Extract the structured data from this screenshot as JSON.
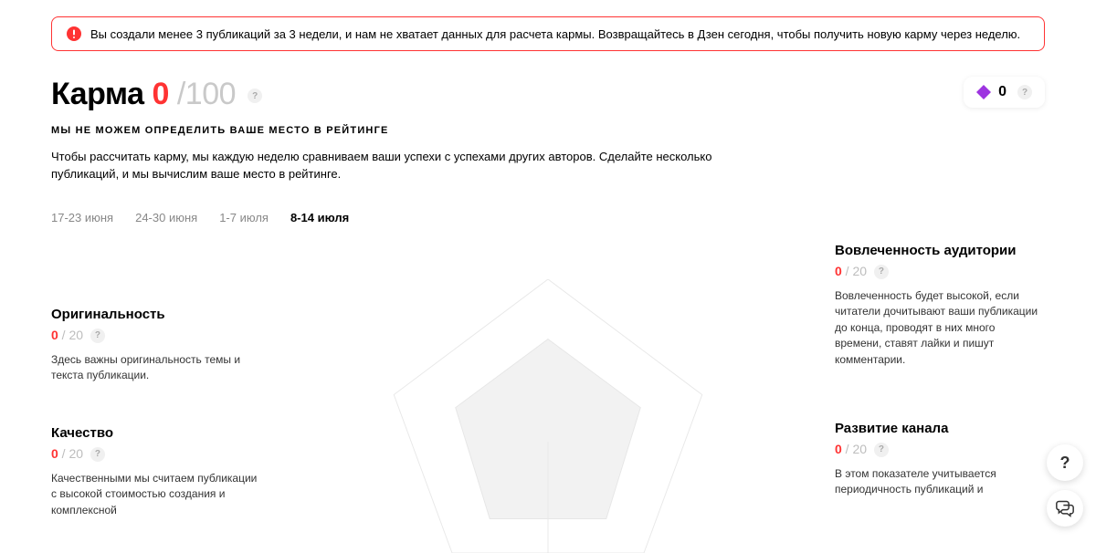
{
  "alert": {
    "text": "Вы создали менее 3 публикаций за 3 недели, и нам не хватает данных для расчета кармы. Возвращайтесь в Дзен сегодня, чтобы получить новую карму через неделю."
  },
  "header": {
    "title_word": "Карма",
    "score": "0",
    "score_sep": " /",
    "score_max": "100"
  },
  "bonus": {
    "value": "0"
  },
  "subtitle": "МЫ НЕ МОЖЕМ ОПРЕДЕЛИТЬ ВАШЕ МЕСТО В РЕЙТИНГЕ",
  "description": "Чтобы рассчитать карму, мы каждую неделю сравниваем ваши успехи с успехами других авторов. Сделайте несколько публикаций, и мы вычислим ваше место в рейтинге.",
  "tabs": [
    {
      "label": "17-23 июня",
      "active": false
    },
    {
      "label": "24-30 июня",
      "active": false
    },
    {
      "label": "1-7 июля",
      "active": false
    },
    {
      "label": "8-14 июля",
      "active": true
    }
  ],
  "metrics": {
    "originality": {
      "title": "Оригинальность",
      "score": "0",
      "sep": " / ",
      "max": "20",
      "desc": "Здесь важны оригинальность темы и текста публикации."
    },
    "quality": {
      "title": "Качество",
      "score": "0",
      "sep": " / ",
      "max": "20",
      "desc": "Качественными мы считаем публикации с высокой стоимостью создания и комплексной"
    },
    "engagement": {
      "title": "Вовлеченность аудитории",
      "score": "0",
      "sep": " / ",
      "max": "20",
      "desc": "Вовлеченность будет высокой, если читатели дочитывают ваши публикации до конца, проводят в них много времени, ставят лайки и пишут комментарии."
    },
    "growth": {
      "title": "Развитие канала",
      "score": "0",
      "sep": " / ",
      "max": "20",
      "desc": "В этом показателе учитывается периодичность публикаций и"
    }
  },
  "fab": {
    "help": "?",
    "chat": ""
  },
  "chart_data": {
    "type": "radar",
    "categories": [
      "Оригинальность",
      "Качество",
      "Вовлеченность аудитории",
      "Развитие канала"
    ],
    "values": [
      0,
      0,
      0,
      0
    ],
    "max": 20,
    "title": "Карма"
  }
}
